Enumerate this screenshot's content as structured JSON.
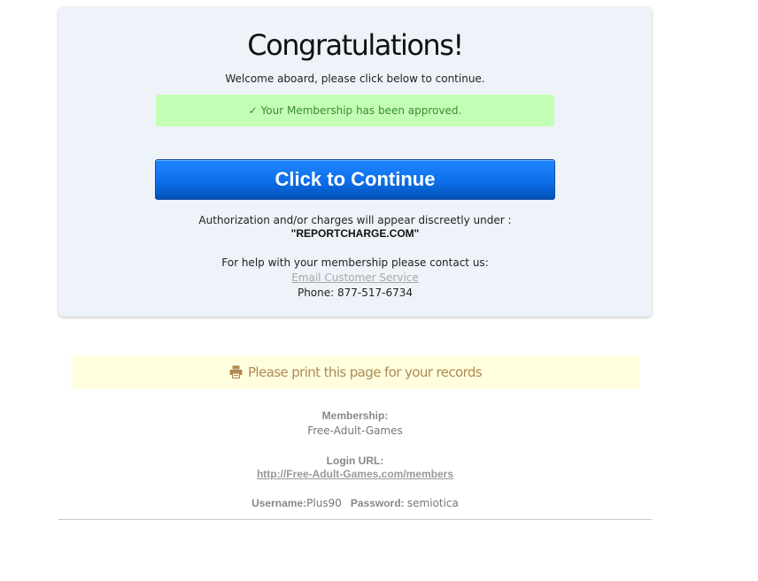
{
  "confirmation": {
    "title": "Congratulations!",
    "welcome": "Welcome aboard, please click below to continue.",
    "approved_message": "✓ Your Membership has been approved.",
    "continue_label": "Click to Continue",
    "auth_notice": "Authorization and/or charges will appear discreetly under :",
    "descriptor": "\"REPORTCHARGE.COM\"",
    "help_text": "For help with your membership please contact us:",
    "email_link": "Email Customer Service",
    "phone": "Phone: 877-517-6734"
  },
  "print": {
    "icon": "printer-icon",
    "message": "Please print this page for your records"
  },
  "details": {
    "membership_label": "Membership:",
    "membership_value": "Free-Adult-Games",
    "login_label": "Login URL:",
    "login_url": "http://Free-Adult-Games.com/members",
    "username_label": "Username:",
    "username_value": "Plus90",
    "password_label": "Password:",
    "password_value": "semiotica"
  },
  "colors": {
    "card_bg": "#eef2f9",
    "approved_bg": "#c2ffb4",
    "button_blue": "#0d6fea",
    "print_bg": "#ffffe0",
    "print_text": "#b08a52"
  }
}
